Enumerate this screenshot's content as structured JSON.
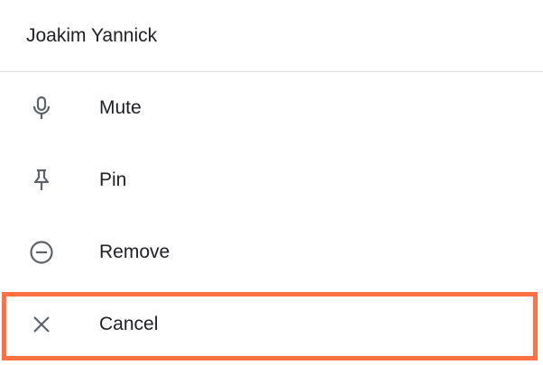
{
  "header": {
    "participant_name": "Joakim Yannick"
  },
  "menu": {
    "items": [
      {
        "label": "Mute",
        "icon": "microphone-icon"
      },
      {
        "label": "Pin",
        "icon": "pin-icon"
      },
      {
        "label": "Remove",
        "icon": "remove-circle-icon"
      },
      {
        "label": "Cancel",
        "icon": "close-icon"
      }
    ]
  },
  "colors": {
    "text": "#202124",
    "icon": "#5f6368",
    "divider": "#dadce0",
    "highlight": "#ff7043"
  }
}
